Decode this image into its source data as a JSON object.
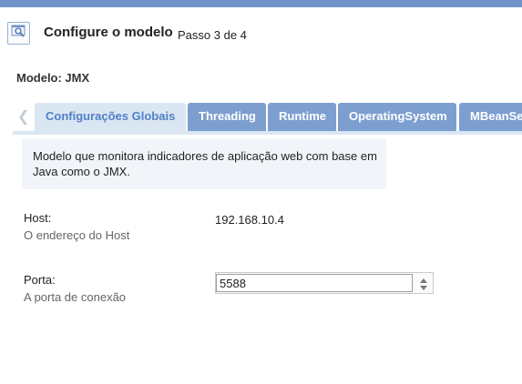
{
  "header": {
    "icon": "search-window-icon",
    "title": "Configure o modelo",
    "step": "Passo 3 de 4"
  },
  "model": {
    "label": "Modelo: JMX"
  },
  "tabs": [
    {
      "label": "Configurações Globais",
      "active": true
    },
    {
      "label": "Threading",
      "active": false
    },
    {
      "label": "Runtime",
      "active": false
    },
    {
      "label": "OperatingSystem",
      "active": false
    },
    {
      "label": "MBeanServer",
      "active": false
    }
  ],
  "description": "Modelo que monitora indicadores de aplicação web com base em Java como o JMX.",
  "fields": {
    "host": {
      "label": "Host:",
      "help": "O endereço do Host",
      "value": "192.168.10.4"
    },
    "port": {
      "label": "Porta:",
      "help": "A porta de conexão",
      "value": "5588"
    }
  },
  "colors": {
    "topbar": "#6f93c6",
    "tab": "#7d9fd0",
    "active_tab_bg": "#dbe6f3",
    "active_tab_text": "#4f81c7"
  }
}
